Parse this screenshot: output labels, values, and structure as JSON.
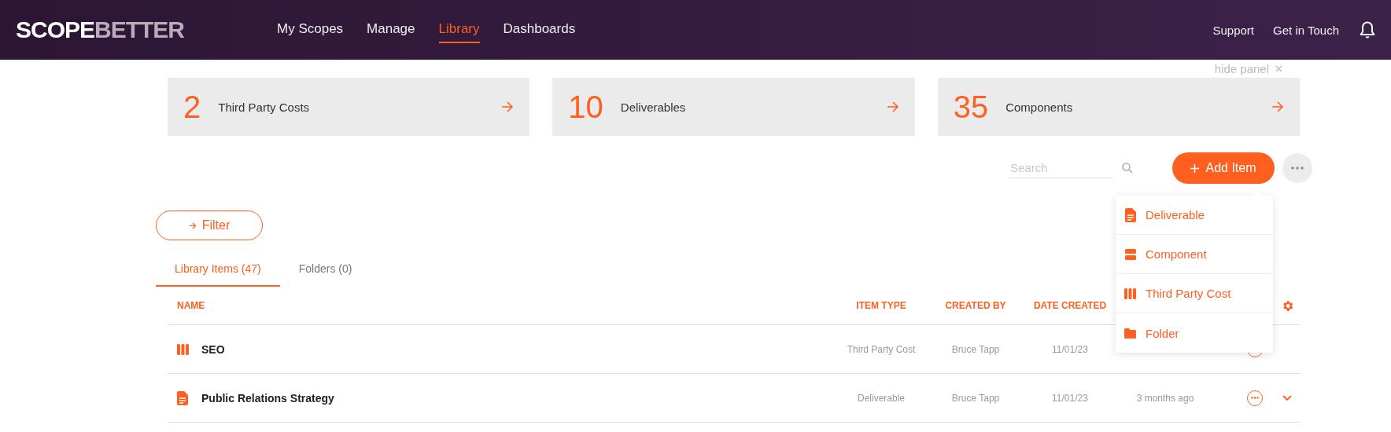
{
  "header": {
    "logo": {
      "part_1": "SCOPE",
      "part_2": "BETTER"
    },
    "nav": [
      {
        "label": "My Scopes",
        "selected": false
      },
      {
        "label": "Manage",
        "selected": false
      },
      {
        "label": "Library",
        "selected": true
      },
      {
        "label": "Dashboards",
        "selected": false
      }
    ],
    "links": [
      "Support",
      "Get in Touch"
    ]
  },
  "panel": {
    "hide_label": "hide panel",
    "cards": [
      {
        "count": "2",
        "label": "Third Party Costs"
      },
      {
        "count": "10",
        "label": "Deliverables"
      },
      {
        "count": "35",
        "label": "Components"
      }
    ]
  },
  "toolbar": {
    "search": {
      "placeholder": "Search"
    },
    "add_button": "Add Item",
    "add_menu": [
      {
        "kind": "deliverable",
        "label": "Deliverable"
      },
      {
        "kind": "component",
        "label": "Component"
      },
      {
        "kind": "third_party_cost",
        "label": "Third Party Cost"
      },
      {
        "kind": "folder",
        "label": "Folder"
      }
    ]
  },
  "filter_button": "Filter",
  "tabs": [
    {
      "label": "Library Items (47)",
      "selected": true
    },
    {
      "label": "Folders (0)",
      "selected": false
    }
  ],
  "table": {
    "columns": [
      "NAME",
      "ITEM TYPE",
      "CREATED BY",
      "DATE CREATED"
    ],
    "rows": [
      {
        "kind": "third_party_cost",
        "name": "SEO",
        "item_type": "Third Party Cost",
        "created_by": "Bruce Tapp",
        "date_created": "11/01/23",
        "expandable": false
      },
      {
        "kind": "deliverable",
        "name": "Public Relations Strategy",
        "item_type": "Deliverable",
        "created_by": "Bruce Tapp",
        "date_created": "11/01/23",
        "age": "3 months ago",
        "expandable": true
      }
    ]
  }
}
